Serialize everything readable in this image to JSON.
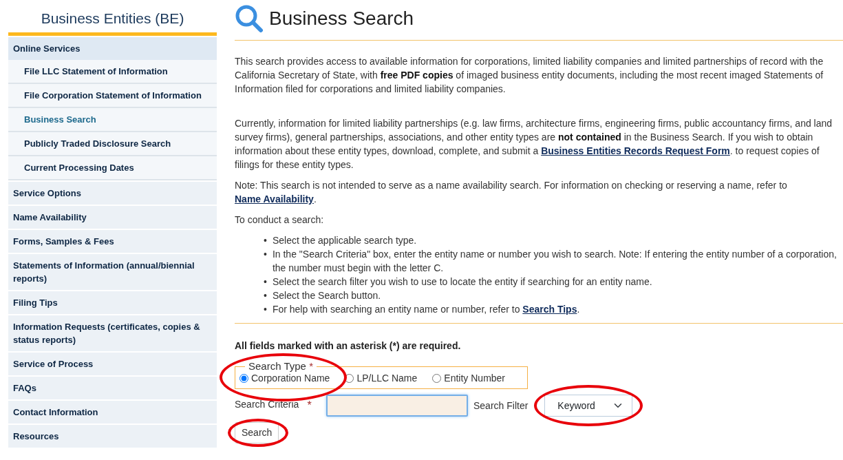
{
  "sidebar": {
    "title": "Business Entities (BE)",
    "items": [
      {
        "label": "Online Services",
        "selected": false,
        "children": [
          {
            "label": "File LLC Statement of Information",
            "selected": false
          },
          {
            "label": "File Corporation Statement of Information",
            "selected": false
          },
          {
            "label": "Business Search",
            "selected": true
          },
          {
            "label": "Publicly Traded Disclosure Search",
            "selected": false
          },
          {
            "label": "Current Processing Dates",
            "selected": false
          }
        ]
      },
      {
        "label": "Service Options",
        "selected": false
      },
      {
        "label": "Name Availability",
        "selected": false
      },
      {
        "label": "Forms, Samples & Fees",
        "selected": false
      },
      {
        "label": "Statements of Information (annual/biennial reports)",
        "selected": false
      },
      {
        "label": "Filing Tips",
        "selected": false
      },
      {
        "label": "Information Requests (certificates, copies & status reports)",
        "selected": false
      },
      {
        "label": "Service of Process",
        "selected": false
      },
      {
        "label": "FAQs",
        "selected": false
      },
      {
        "label": "Contact Information",
        "selected": false
      },
      {
        "label": "Resources",
        "selected": false
      }
    ]
  },
  "page": {
    "title": "Business Search",
    "paragraphs": [
      [
        {
          "kind": "text",
          "text": "This search provides access to available information for corporations, limited liability companies and limited partnerships of record with the California Secretary of State, with **free PDF copies** of imaged business entity documents, including the most recent imaged Statements of Information filed for corporations and limited liability companies."
        }
      ],
      [
        {
          "kind": "text",
          "text": "Currently, information for limited liability partnerships (e.g. law firms, architecture firms, engineering firms, public accountancy firms, and land survey firms), general partnerships, associations, and other entity types are **not contained** in the Business Search. If you wish to obtain information about these entity types, download, complete, and submit a "
        },
        {
          "kind": "link",
          "text": "Business Entities Records Request Form"
        },
        {
          "kind": "text",
          "text": ". to request copies of filings for these entity types."
        }
      ],
      [
        {
          "kind": "text",
          "text": "Note: This search is not intended to serve as a name availability search. For information on checking or reserving a name, refer to "
        },
        {
          "kind": "link",
          "text": "Name Availability"
        },
        {
          "kind": "text",
          "text": "."
        }
      ],
      [
        {
          "kind": "text",
          "text": "To conduct a search:"
        }
      ]
    ],
    "steps": [
      {
        "marker": "•",
        "segments": [
          {
            "kind": "text",
            "text": "Select the applicable search type."
          }
        ]
      },
      {
        "marker": "•",
        "segments": [
          {
            "kind": "text",
            "text": "In the \"Search Criteria\" box, enter the entity name or number you wish to search. Note: If entering the entity number of a corporation, the number must begin with the letter C."
          }
        ]
      },
      {
        "marker": "•",
        "segments": [
          {
            "kind": "text",
            "text": "Select the search filter you wish to use to locate the entity if searching for an entity name."
          }
        ]
      },
      {
        "marker": "•",
        "segments": [
          {
            "kind": "text",
            "text": "Select the Search button."
          }
        ]
      },
      {
        "marker": "•",
        "segments": [
          {
            "kind": "text",
            "text": "For help with searching an entity name or number, refer to "
          },
          {
            "kind": "link",
            "text": "Search Tips"
          },
          {
            "kind": "text",
            "text": "."
          }
        ]
      }
    ],
    "required_note": "All fields marked with an asterisk (*) are required.",
    "search_type": {
      "legend": "Search Type",
      "required_mark": "*",
      "circled": true,
      "options": [
        {
          "label": "Corporation Name",
          "selected": true
        },
        {
          "label": "LP/LLC Name",
          "selected": false
        },
        {
          "label": "Entity Number",
          "selected": false
        }
      ]
    },
    "criteria": {
      "label": "Search Criteria",
      "required_mark": "*",
      "focused": true
    },
    "filter": {
      "label": "Search Filter",
      "value": "Keyword",
      "circled": true
    },
    "search_button": {
      "label": "Search",
      "circled": true
    }
  }
}
